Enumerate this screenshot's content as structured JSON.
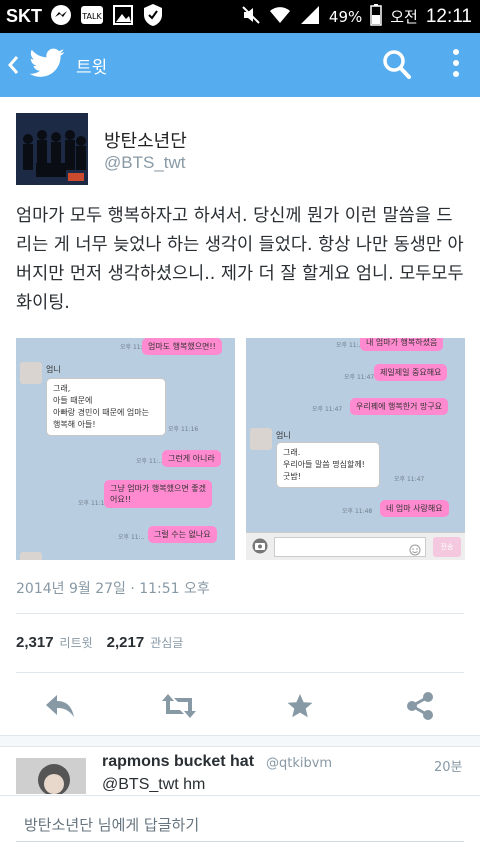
{
  "status_bar": {
    "carrier": "SKT",
    "battery": "49%",
    "time_period": "오전",
    "time": "12:11",
    "icons": [
      "messenger-icon",
      "kakaotalk-icon",
      "gallery-icon",
      "shield-icon",
      "mute-icon",
      "wifi-icon",
      "signal-icon",
      "battery-icon"
    ]
  },
  "header": {
    "title": "트윗",
    "icons": [
      "back-icon",
      "twitter-bird-icon",
      "search-icon",
      "overflow-menu-icon"
    ]
  },
  "tweet": {
    "author_name": "방탄소년단",
    "author_handle": "@BTS_twt",
    "text": "엄마가 모두 행복하자고 하셔서. 당신께 뭔가 이런 말씀을 드리는 게 너무 늦었나 하는 생각이 들었다. 항상 나만 동생만 아버지만 먼저 생각하셨으니.. 제가 더 잘 할게요 엄니. 모두모두 화이팅.",
    "date": "2014년 9월 27일 · 11:51 오후",
    "retweets": "2,317",
    "retweets_label": "리트윗",
    "favorites": "2,217",
    "favorites_label": "관심글"
  },
  "chat_left": {
    "sender": "엄니",
    "messages": [
      {
        "side": "right",
        "text": "엄마도 행복했으면!!"
      },
      {
        "side": "left",
        "text": "그래,\n아들 때문에\n아빠랑 경민이 때문에 엄마는\n행복해 아들!"
      },
      {
        "side": "right",
        "text": "그런게 아니라"
      },
      {
        "side": "right",
        "text": "그냥 엄마가 행복했으면 좋겠\n어요!!"
      },
      {
        "side": "right",
        "text": "그럴 수는 없나요"
      }
    ]
  },
  "chat_right": {
    "sender": "엄니",
    "messages": [
      {
        "side": "right",
        "text": "내 엄마가 행복하셨음"
      },
      {
        "side": "right",
        "text": "제일제일 중요해요"
      },
      {
        "side": "right",
        "text": "우리꿰에 행복한거 망구요"
      },
      {
        "side": "left",
        "text": "그래.\n우리아들 말씀 명심할께!\n굿밤!"
      },
      {
        "side": "right",
        "text": "네 엄마 사랑해요"
      }
    ],
    "send_label": "전송"
  },
  "actions": {
    "icons": [
      "reply-icon",
      "retweet-icon",
      "favorite-star-icon",
      "share-icon"
    ]
  },
  "reply": {
    "name": "rapmons bucket hat",
    "handle": "@qtkibvm",
    "time": "20분",
    "text": "@BTS_twt hm"
  },
  "composer": {
    "placeholder": "방탄소년단 님에게 답글하기"
  },
  "colors": {
    "accent": "#55acee",
    "status_bar": "#000000",
    "secondary_text": "#8899a6"
  }
}
